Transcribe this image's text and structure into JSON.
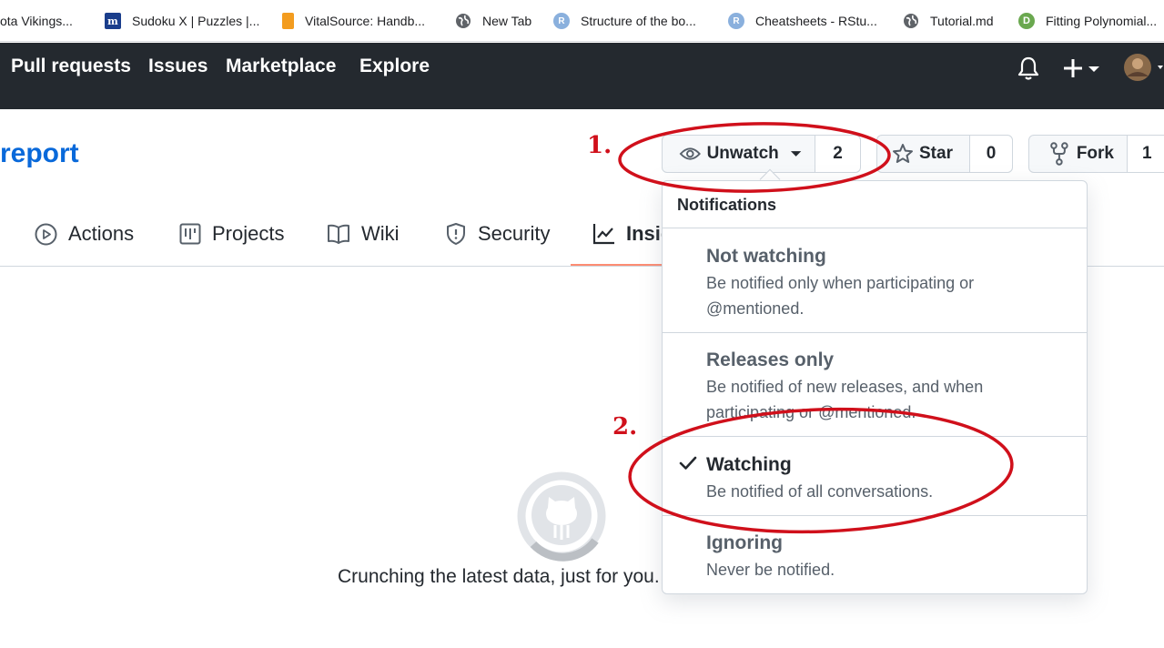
{
  "bookmarks": [
    {
      "label": "ota Vikings...",
      "icon": "none"
    },
    {
      "label": "Sudoku X | Puzzles |...",
      "icon": "m-logo-icon",
      "glyph": "m"
    },
    {
      "label": "VitalSource: Handb...",
      "icon": "bookmark-orange-icon"
    },
    {
      "label": "New Tab",
      "icon": "globe-icon"
    },
    {
      "label": "Structure of the bo...",
      "icon": "r-icon",
      "glyph": "R"
    },
    {
      "label": "Cheatsheets - RStu...",
      "icon": "r-icon",
      "glyph": "R"
    },
    {
      "label": "Tutorial.md",
      "icon": "globe-icon"
    },
    {
      "label": "Fitting Polynomial...",
      "icon": "d-icon",
      "glyph": "D"
    }
  ],
  "header": {
    "nav": [
      "Pull requests",
      "Issues",
      "Marketplace",
      "Explore"
    ]
  },
  "repo": {
    "name": "report"
  },
  "actions": {
    "watch_label": "Unwatch",
    "watch_count": "2",
    "star_label": "Star",
    "star_count": "0",
    "fork_label": "Fork",
    "fork_count": "1"
  },
  "tabs": [
    "Actions",
    "Projects",
    "Wiki",
    "Security",
    "Insights"
  ],
  "loading": {
    "text": "Crunching the latest data, just for you."
  },
  "dropdown": {
    "title": "Notifications",
    "options": [
      {
        "title": "Not watching",
        "description": "Be notified only when participating or @mentioned.",
        "selected": false
      },
      {
        "title": "Releases only",
        "description": "Be notified of new releases, and when participating or @mentioned.",
        "selected": false
      },
      {
        "title": "Watching",
        "description": "Be notified of all conversations.",
        "selected": true
      },
      {
        "title": "Ignoring",
        "description": "Never be notified.",
        "selected": false
      }
    ]
  },
  "annotations": {
    "step1": "1.",
    "step2": "2.",
    "color": "#d0101b"
  },
  "colors": {
    "header_bg": "#24292f",
    "link_blue": "#0969da",
    "tab_underline": "#fd8c73"
  }
}
